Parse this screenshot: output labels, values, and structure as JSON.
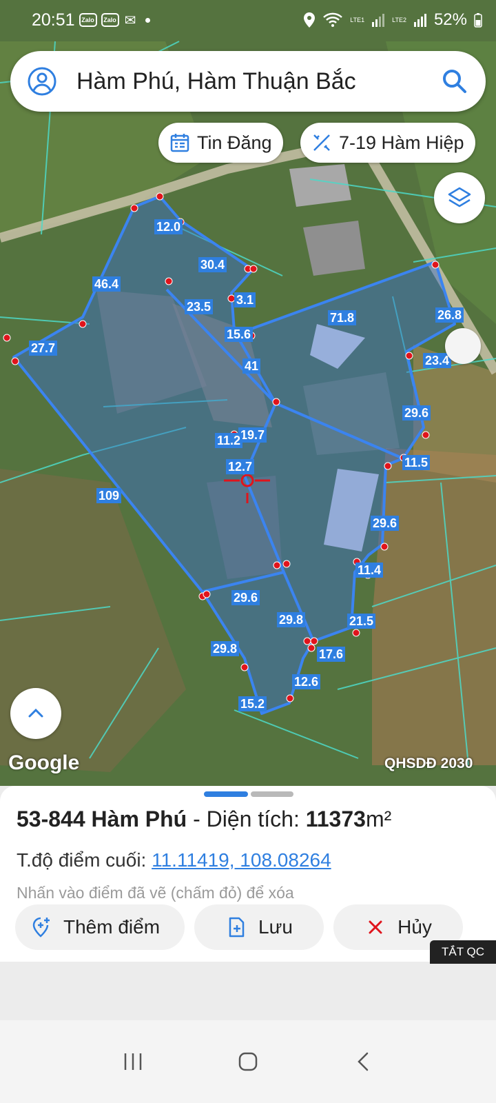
{
  "status_bar": {
    "time": "20:51",
    "apps": [
      "Zalo",
      "Zalo"
    ],
    "lte1": "LTE1",
    "lte2": "LTE2",
    "battery": "52%"
  },
  "search": {
    "text": "Hàm Phú, Hàm Thuận Bắc"
  },
  "chips": {
    "tin_dang": "Tin Đăng",
    "ham_hiep": "7-19 Hàm Hiệp"
  },
  "map": {
    "google_label": "Google",
    "layer_label": "QHSDĐ 2030",
    "measurements": [
      "12.0",
      "30.4",
      "46.4",
      "23.5",
      "3.1",
      "71.8",
      "26.8",
      "15.6",
      "27.7",
      "41",
      "23.4",
      "29.6",
      "19.7",
      "11.2",
      "11.5",
      "12.7",
      "109",
      "29.6",
      "11.4",
      "29.6",
      "29.8",
      "21.5",
      "29.8",
      "17.6",
      "12.6",
      "15.2"
    ]
  },
  "sheet": {
    "parcel": "53-844 Hàm Phú",
    "area_label": " - Diện tích: ",
    "area_value": "11373",
    "area_unit": "m²",
    "coord_label": "T.độ điểm cuối: ",
    "coord_value": "11.11419, 108.08264",
    "hint": "Nhấn vào điểm đã vẽ (chấm đỏ) để xóa",
    "add_point": "Thêm điểm",
    "save": "Lưu",
    "cancel": "Hủy",
    "ad_off": "TẮT QC"
  },
  "colors": {
    "accent": "#2f7fe0",
    "pin": "#e0141c",
    "parcel_line": "#4dd9c8"
  }
}
